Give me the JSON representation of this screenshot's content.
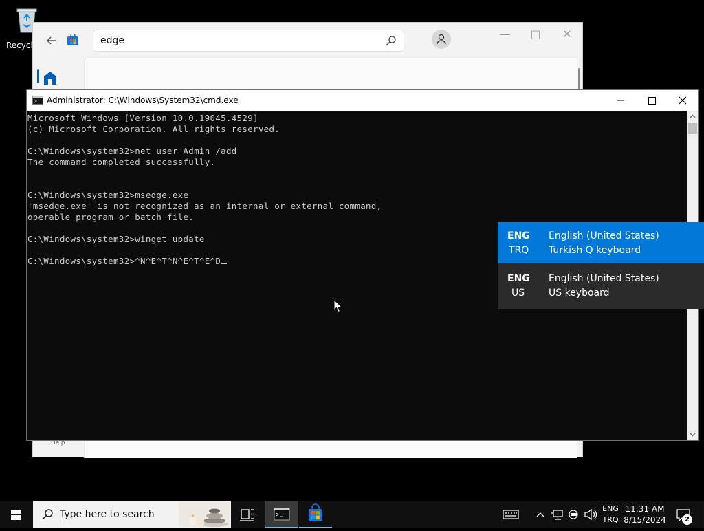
{
  "desktop": {
    "recycle_bin_label": "Recycle"
  },
  "store": {
    "search_value": "edge",
    "help_label": "Help"
  },
  "cmd": {
    "title": "Administrator: C:\\Windows\\System32\\cmd.exe",
    "lines": [
      "Microsoft Windows [Version 10.0.19045.4529]",
      "(c) Microsoft Corporation. All rights reserved.",
      "",
      "C:\\Windows\\system32>net user Admin /add",
      "The command completed successfully.",
      "",
      "",
      "C:\\Windows\\system32>msedge.exe",
      "'msedge.exe' is not recognized as an internal or external command,",
      "operable program or batch file.",
      "",
      "C:\\Windows\\system32>winget update",
      "",
      "C:\\Windows\\system32>^N^E^T^N^E^T^E^D"
    ]
  },
  "language_flyout": {
    "items": [
      {
        "code": "ENG",
        "subcode": "TRQ",
        "language": "English (United States)",
        "keyboard": "Turkish Q keyboard",
        "selected": true
      },
      {
        "code": "ENG",
        "subcode": "US",
        "language": "English (United States)",
        "keyboard": "US keyboard",
        "selected": false
      }
    ]
  },
  "taskbar": {
    "search_placeholder": "Type here to search",
    "lang_top": "ENG",
    "lang_bottom": "TRQ",
    "time": "11:31 AM",
    "date": "8/15/2024",
    "notification_count": "2"
  },
  "colors": {
    "accent": "#0078d7",
    "terminal_bg": "#0c0c0c",
    "terminal_text": "#cccccc"
  }
}
